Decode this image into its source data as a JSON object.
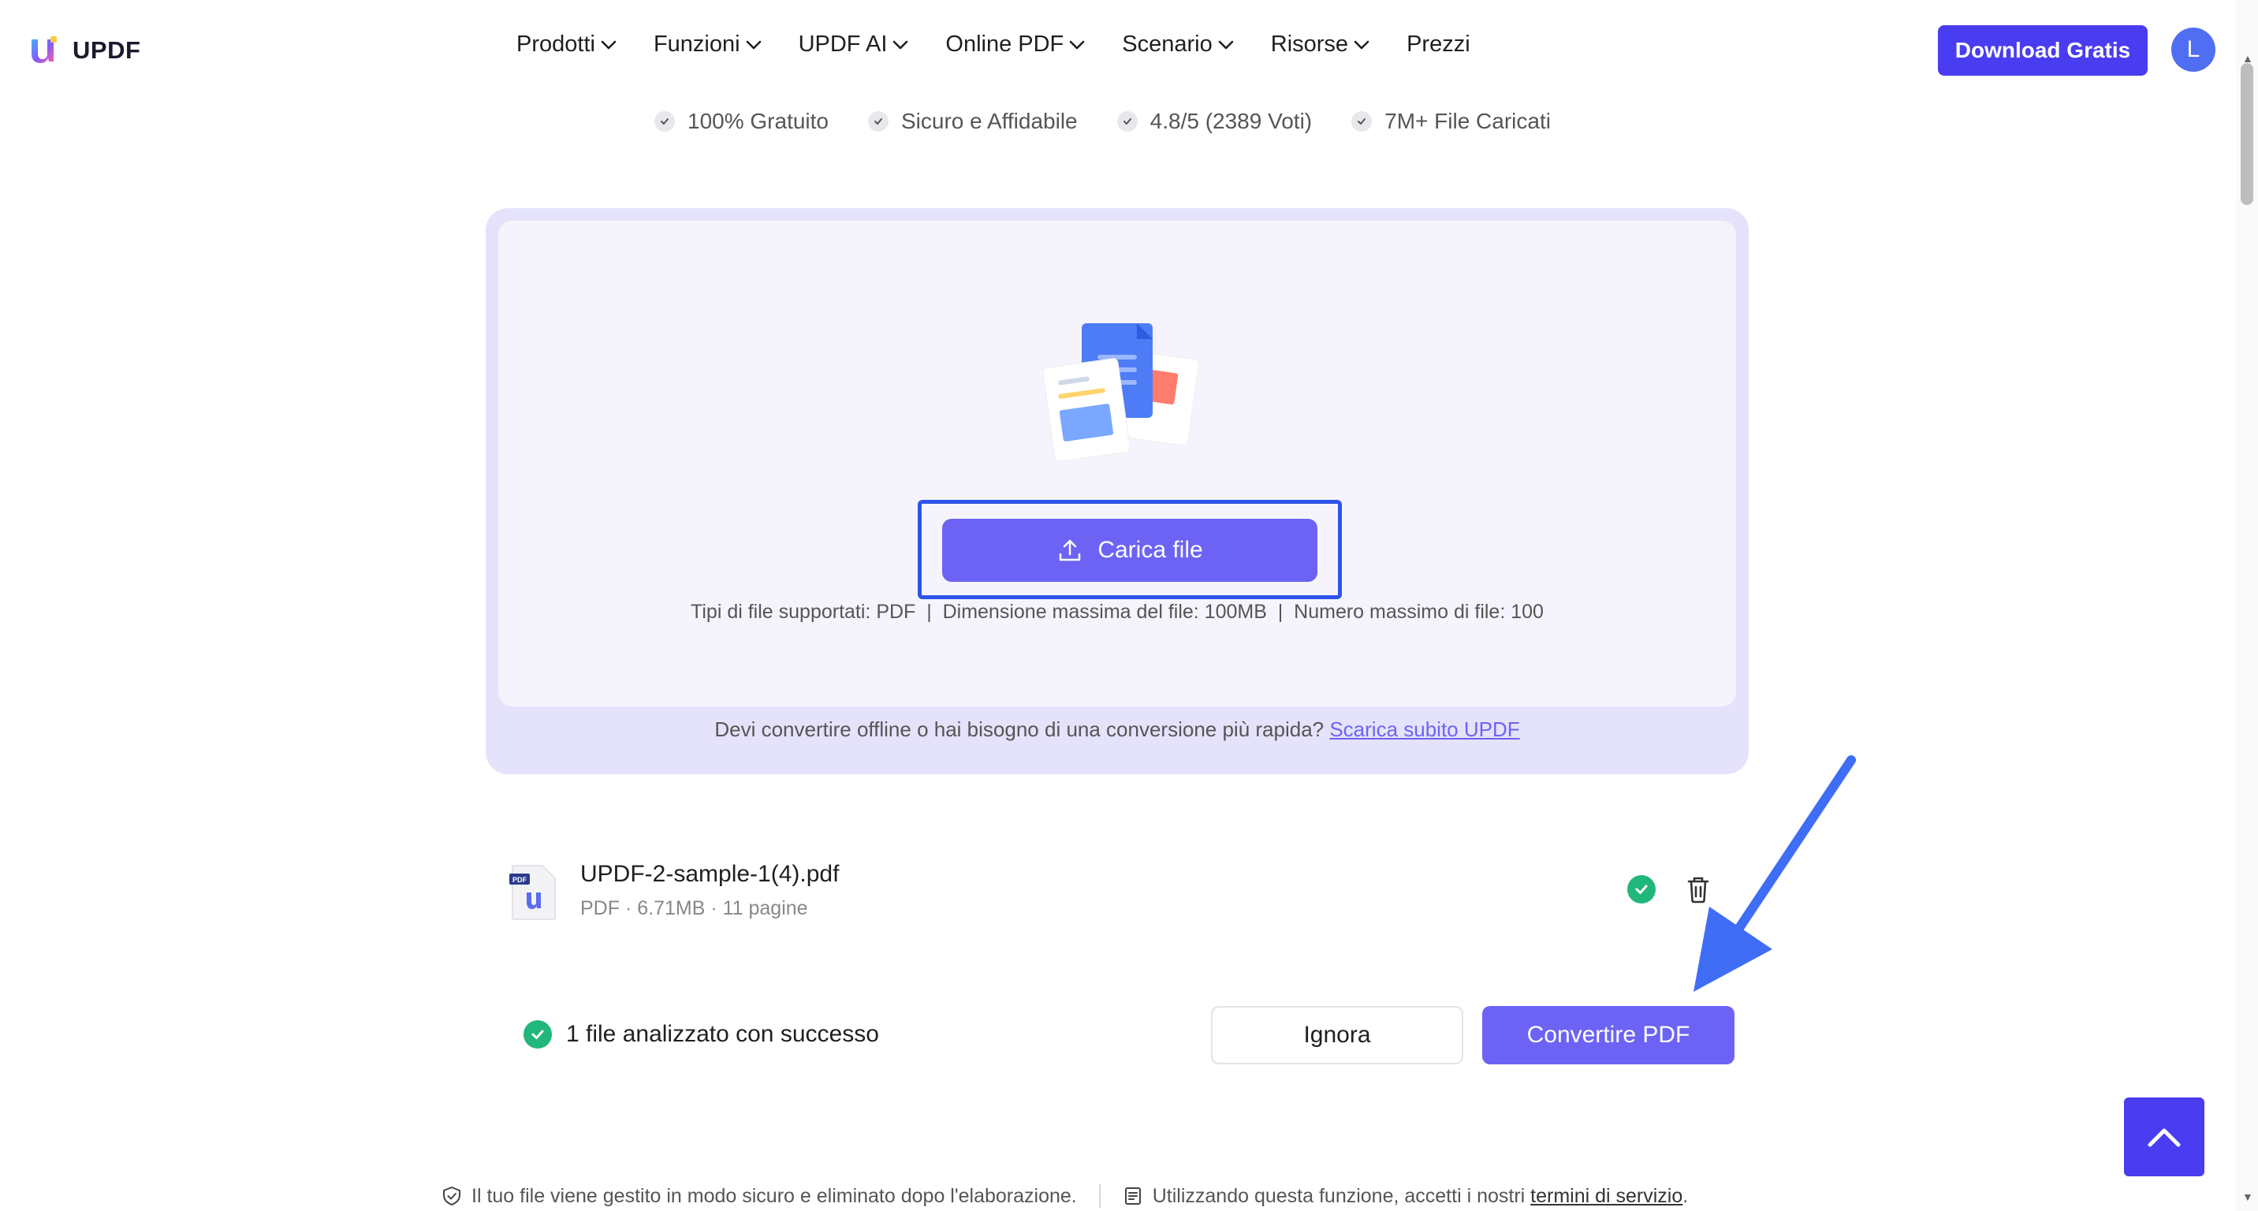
{
  "header": {
    "logo_text": "UPDF",
    "nav": [
      {
        "label": "Prodotti",
        "has_dropdown": true
      },
      {
        "label": "Funzioni",
        "has_dropdown": true
      },
      {
        "label": "UPDF AI",
        "has_dropdown": true
      },
      {
        "label": "Online PDF",
        "has_dropdown": true
      },
      {
        "label": "Scenario",
        "has_dropdown": true
      },
      {
        "label": "Risorse",
        "has_dropdown": true
      },
      {
        "label": "Prezzi",
        "has_dropdown": false
      }
    ],
    "download_label": "Download Gratis",
    "avatar_initial": "L"
  },
  "badges": [
    "100% Gratuito",
    "Sicuro e Affidabile",
    "4.8/5 (2389 Voti)",
    "7M+ File Caricati"
  ],
  "upload": {
    "button_label": "Carica file",
    "file_types": "Tipi di file supportati: PDF  |  Dimensione massima del file: 100MB  |  Numero massimo di file: 100",
    "offline_text": "Devi convertire offline o hai bisogno di una conversione più rapida? ",
    "offline_link": "Scarica subito UPDF"
  },
  "file": {
    "name": "UPDF-2-sample-1(4).pdf",
    "meta": "PDF · 6.71MB · 11 pagine"
  },
  "status": {
    "message": "1 file analizzato con successo"
  },
  "actions": {
    "ignore_label": "Ignora",
    "convert_label": "Convertire PDF"
  },
  "footer": {
    "secure_note": "Il tuo file viene gestito in modo sicuro e eliminato dopo l'elaborazione.",
    "terms_prefix": "Utilizzando questa funzione, accetti i nostri ",
    "terms_link": "termini di servizio",
    "terms_suffix": "."
  },
  "colors": {
    "brand": "#4a3cf0",
    "primary_button": "#6c63f5",
    "success": "#21b67a",
    "focus_outline": "#2f54eb",
    "annotation_arrow": "#3f6df5"
  }
}
